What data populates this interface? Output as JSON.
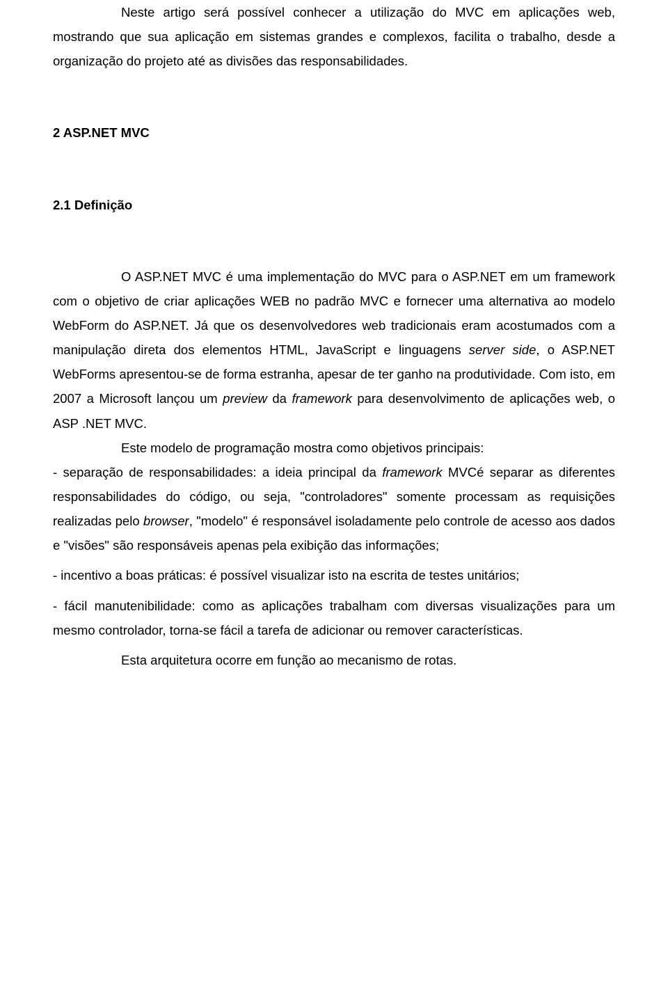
{
  "paragraphs": {
    "intro": "Neste artigo será possível conhecer a utilização do MVC em aplicações web, mostrando que sua aplicação em sistemas grandes e complexos, facilita o trabalho, desde a organização do projeto até as divisões das responsabilidades."
  },
  "headings": {
    "h2": "2 ASP.NET MVC",
    "h3": "2.1 Definição"
  },
  "body": {
    "p1_part1": "O ASP.NET MVC é uma implementação do MVC para o ASP.NET em um framework com o objetivo de criar aplicações WEB no padrão MVC e fornecer uma alternativa ao modelo WebForm do ASP.NET. Já que os desenvolvedores web tradicionais eram acostumados com a manipulação direta dos elementos HTML, JavaScript e linguagens ",
    "p1_italic1": "server side",
    "p1_part2": ", o ASP.NET WebForms apresentou-se de forma estranha, apesar de ter ganho na produtividade. Com isto, em 2007 a Microsoft lançou um ",
    "p1_italic2": "preview",
    "p1_part3": " da ",
    "p1_italic3": "framework",
    "p1_part4": " para desenvolvimento de aplicações web, o ASP .NET MVC.",
    "p2": "Este modelo de programação mostra como objetivos principais:"
  },
  "list": {
    "item1_part1": "- separação de responsabilidades: a ideia principal da ",
    "item1_italic1": "framework",
    "item1_part2": " MVCé separar as diferentes responsabilidades do código, ou seja, \"controladores\" somente processam as requisições realizadas pelo ",
    "item1_italic2": "browser",
    "item1_part3": ", \"modelo\" é responsável isoladamente pelo controle de acesso aos dados e \"visões\" são responsáveis apenas pela exibição das informações;",
    "item2": "- incentivo a boas práticas: é possível visualizar isto na escrita de testes unitários;",
    "item3": "- fácil manutenibilidade: como as aplicações trabalham com diversas visualizações para um mesmo controlador, torna-se fácil a tarefa de adicionar ou remover características."
  },
  "conclusion": "Esta arquitetura ocorre em função ao mecanismo de rotas."
}
